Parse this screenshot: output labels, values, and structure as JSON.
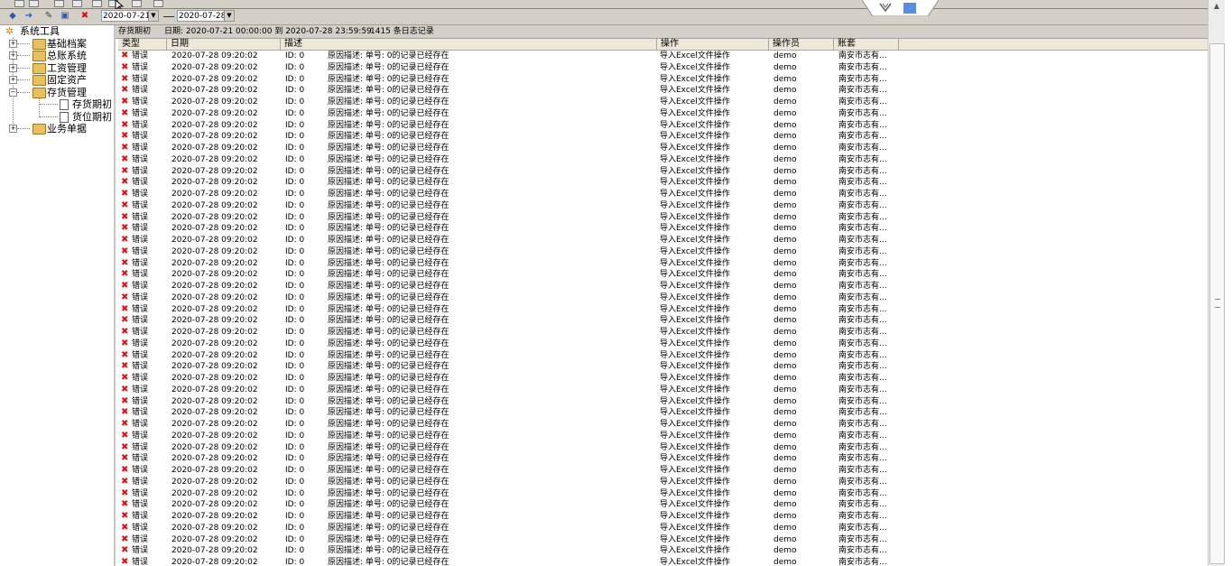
{
  "toolbar": {
    "date_from": "2020-07-21",
    "date_to": "2020-07-28"
  },
  "tree": {
    "root": "系统工具",
    "nodes": [
      {
        "label": "基础档案"
      },
      {
        "label": "总账系统"
      },
      {
        "label": "工资管理"
      },
      {
        "label": "固定资产"
      },
      {
        "label": "存货管理"
      },
      {
        "label": "存货期初"
      },
      {
        "label": "货位期初"
      },
      {
        "label": "业务单据"
      }
    ]
  },
  "info": {
    "section": "存货期初",
    "range": "日期: 2020-07-21 00:00:00 到 2020-07-28 23:59:59",
    "count": "1415 条日志记录"
  },
  "columns": [
    "类型",
    "日期",
    "描述",
    "操作",
    "操作员",
    "账套"
  ],
  "row_template": {
    "type": "错误",
    "date": "2020-07-28 09:20:02",
    "id": "ID: 0",
    "desc": "原因描述: 单号: 0的记录已经存在",
    "op": "导入Excel文件操作",
    "user": "demo",
    "account": "南安市志有..."
  },
  "visible_rows": 45,
  "colors": {
    "error_icon": "#d11111",
    "panel_bg": "#d4d0c8"
  }
}
